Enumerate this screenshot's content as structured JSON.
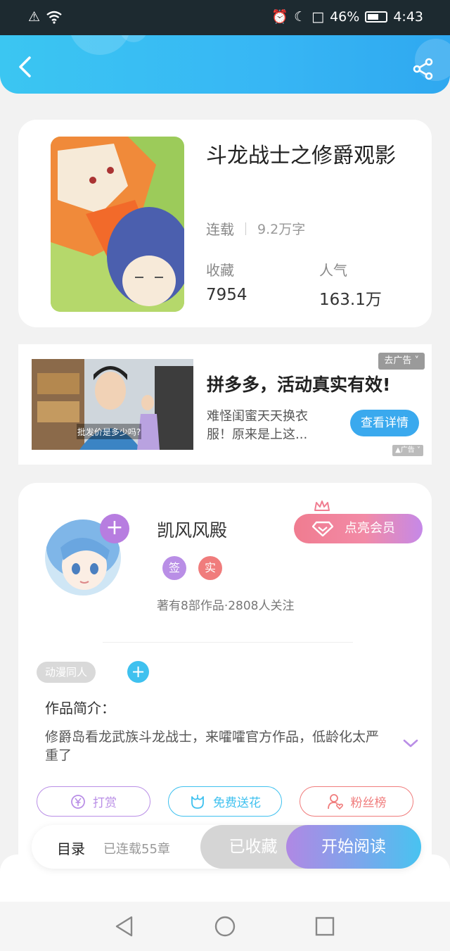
{
  "status_bar": {
    "battery_percent": "46%",
    "time": "4:43"
  },
  "book": {
    "title": "斗龙战士之修爵观影",
    "status": "连载",
    "word_count": "9.2万字",
    "favorites_label": "收藏",
    "favorites_value": "7954",
    "popularity_label": "人气",
    "popularity_value": "163.1万"
  },
  "ad": {
    "close_label": "去广告",
    "image_caption": "批发价是多少吗?",
    "title": "拼多多，活动真实有效!",
    "description": "难怪闺蜜天天换衣服！原来是上这...",
    "cta_label": "查看详情",
    "mark_label": "广告"
  },
  "author": {
    "name": "凯风风殿",
    "badge_sign": "签",
    "badge_real": "实",
    "meta": "著有8部作品·2808人关注",
    "vip_label": "点亮会员",
    "tag": "动漫同人",
    "intro_title": "作品简介：",
    "intro_text": "修爵岛看龙武族斗龙战士，来嚯嚯官方作品，低龄化太严重了"
  },
  "actions": {
    "tip_label": "打赏",
    "flower_label": "免费送花",
    "fans_label": "粉丝榜",
    "tip_color": "#b98ee6",
    "flower_color": "#3fc1ef",
    "fans_color": "#f07c7c"
  },
  "bottom_bar": {
    "toc_label": "目录",
    "chapter_count": "已连载55章",
    "collected_label": "已收藏",
    "read_label": "开始阅读"
  }
}
